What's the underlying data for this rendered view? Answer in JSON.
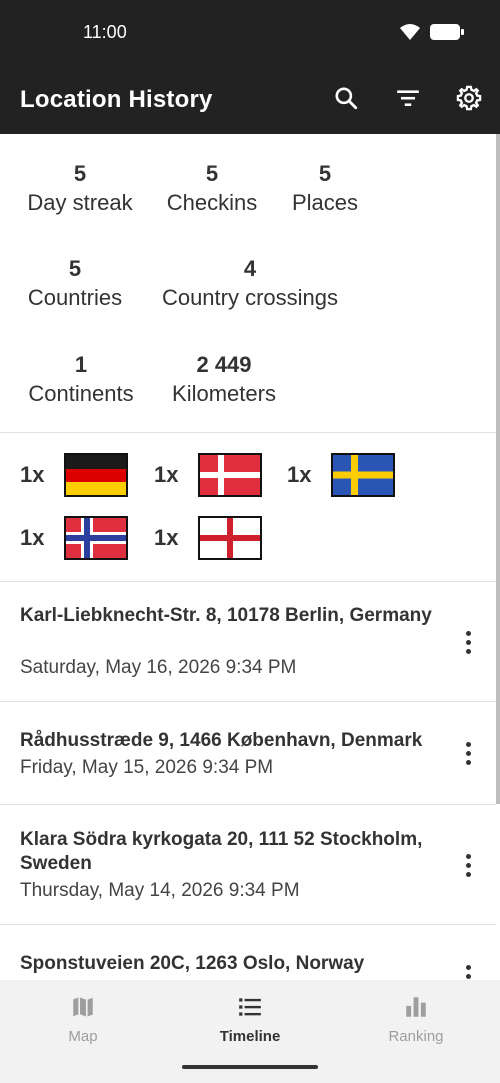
{
  "status_bar": {
    "time": "11:00"
  },
  "app_bar": {
    "title": "Location History",
    "actions": [
      "search-icon",
      "filter-icon",
      "gear-icon"
    ]
  },
  "stats": [
    {
      "value": "5",
      "label": "Day streak"
    },
    {
      "value": "5",
      "label": "Checkins"
    },
    {
      "value": "5",
      "label": "Places"
    },
    {
      "value": "5",
      "label": "Countries"
    },
    {
      "value": "4",
      "label": "Country crossings"
    },
    {
      "value": "1",
      "label": "Continents"
    },
    {
      "value": "2 449",
      "label": "Kilometers"
    }
  ],
  "flags": [
    {
      "count": "1x",
      "country": "germany-flag"
    },
    {
      "count": "1x",
      "country": "denmark-flag"
    },
    {
      "count": "1x",
      "country": "sweden-flag"
    },
    {
      "count": "1x",
      "country": "norway-flag"
    },
    {
      "count": "1x",
      "country": "england-flag"
    }
  ],
  "history": [
    {
      "address": "Karl-Liebknecht-Str. 8, 10178 Berlin, Germany",
      "date": "Saturday, May 16, 2026 9:34 PM"
    },
    {
      "address": "Rådhusstræde 9, 1466 København, Denmark",
      "date": "Friday, May 15, 2026 9:34 PM"
    },
    {
      "address": "Klara Södra kyrkogata 20, 111 52 Stockholm, Sweden",
      "date": "Thursday, May 14, 2026 9:34 PM"
    },
    {
      "address": "Sponstuveien 20C, 1263 Oslo, Norway",
      "date": ""
    }
  ],
  "bottom_nav": {
    "items": [
      {
        "label": "Map",
        "icon": "map-icon"
      },
      {
        "label": "Timeline",
        "icon": "list-icon",
        "active": true
      },
      {
        "label": "Ranking",
        "icon": "bar-chart-icon"
      }
    ]
  },
  "colors": {
    "app_bar": "#222222",
    "background": "#ffffff",
    "nav_background": "#f2f2f2"
  }
}
